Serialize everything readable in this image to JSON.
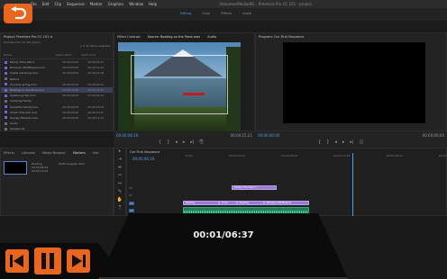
{
  "menubar": {
    "items": [
      "File",
      "Edit",
      "Clip",
      "Sequence",
      "Marker",
      "Graphics",
      "Window",
      "Help"
    ],
    "path": "/Volumes/Media/06... Premiere Pro CC 101 - project"
  },
  "workspace": {
    "tabs": [
      "Editing",
      "Color",
      "Effects",
      "Audio"
    ],
    "active": "Editing"
  },
  "project": {
    "title": "Project: Premiere Pro CC 101 ≡",
    "subtitle": "Premiere Pro CC 101.prproj",
    "count": "1 of 16 items selected",
    "columns": [
      "Name",
      "Media Start",
      "Media End"
    ],
    "rows": [
      {
        "name": "Family Time Part 1",
        "start": "00;00;00;00",
        "end": "00;00;45;22"
      },
      {
        "name": "Brooklyn Wildflowers.mov",
        "start": "00;00;00;00",
        "end": "00;00;12;03"
      },
      {
        "name": "Castle Camping.mov",
        "start": "00;00;00;00",
        "end": "00;00;14;08"
      },
      {
        "name": "Nature",
        "start": "",
        "end": ""
      },
      {
        "name": "Crumple & Fog.mov",
        "start": "00;00;00;00",
        "end": "00;00;08;12"
      },
      {
        "name": "Boating on the Pond.mov",
        "start": "00;00;00;00",
        "end": "00;00;15;21"
      },
      {
        "name": "Splashing Fish.mov",
        "start": "00;00;00;00",
        "end": "00;00;06;17"
      },
      {
        "name": "Camping Family",
        "start": "",
        "end": ""
      },
      {
        "name": "Campfire Family.mov",
        "start": "00;00;00;00",
        "end": "00;00;19;04"
      },
      {
        "name": "Check This Out.mov",
        "start": "00;00;00;00",
        "end": "00;00;10;22"
      },
      {
        "name": "Grassy Hillsides.mov",
        "start": "00;00;00;00",
        "end": "00;00;12;11"
      },
      {
        "name": "Audio",
        "start": "",
        "end": ""
      },
      {
        "name": "Sequences",
        "start": "",
        "end": ""
      }
    ]
  },
  "source": {
    "tabs": [
      "Effect Controls",
      "Source: Boating on the Pond.mov",
      "Audio"
    ],
    "timecode": "00;00;06;16",
    "end_timecode": "00;00;15;21"
  },
  "program": {
    "title": "Program: Our First Sequence",
    "timecode": "00;00;00;00",
    "end_timecode": "00;00;00;00"
  },
  "effects": {
    "tabs": [
      "Effects",
      "Libraries",
      "Media Browser",
      "Markers",
      "Info"
    ],
    "active": "Markers",
    "clip_lines": [
      "Boating",
      "00;00;06;16",
      "00;00;12;03"
    ],
    "clip_title": "Brett Langdon Marr"
  },
  "timeline": {
    "sequence": "Our First Sequence",
    "timecode": "00;00;06;16",
    "ruler": [
      "00;00",
      "00;00;04;00",
      "00;00;08;00",
      "00;00;12;00",
      "00;00;16;00",
      "00;00;20;00"
    ],
    "tracks": [
      "V3",
      "V2",
      "V1",
      "A1",
      "A2",
      "A3"
    ],
    "clips_v": [
      {
        "label": "Family Time Part 1",
        "track": "V2"
      },
      {
        "label": "Boating",
        "track": "V1"
      },
      {
        "label": "Crum",
        "track": "V1"
      },
      {
        "label": "Boating",
        "track": "V1"
      },
      {
        "label": "Brooklyn Wildflowers",
        "track": "V1"
      }
    ]
  },
  "player": {
    "time": "00:01/06:37",
    "progress": 0.003
  },
  "icons": [
    "back-icon",
    "skip-back-icon",
    "pause-icon",
    "skip-forward-icon"
  ],
  "colors": {
    "accent": "#e8661f",
    "timecode": "#4d9de6",
    "video_clip": "#9a7ad6",
    "audio_clip": "#1f7a55"
  }
}
